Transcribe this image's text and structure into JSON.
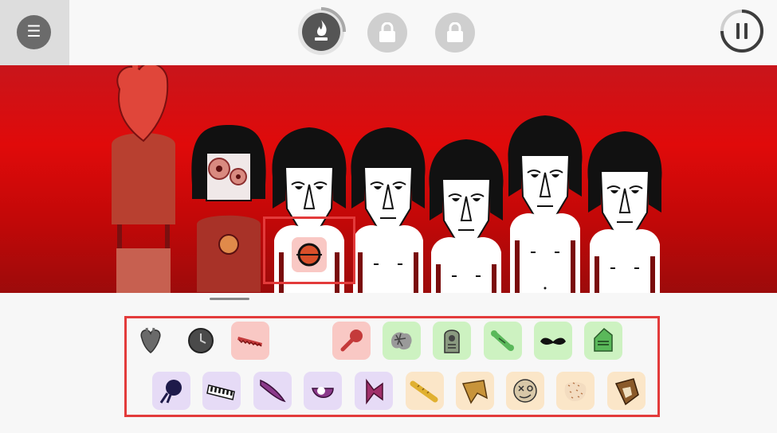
{
  "toolbar": {
    "menu_icon": "hamburger-icon",
    "bonus_buttons": [
      {
        "icon": "flame-icon",
        "state": "active",
        "progress": 0.35
      },
      {
        "icon": "lock-icon",
        "state": "locked"
      },
      {
        "icon": "lock-icon",
        "state": "locked"
      }
    ],
    "pause_icon": "pause-icon",
    "pause_progress": 0.25
  },
  "stage": {
    "background": "#d40b0b",
    "performers": [
      {
        "slot": 1,
        "state": "anatomical-heart"
      },
      {
        "slot": 2,
        "state": "gears-face"
      },
      {
        "slot": 3,
        "state": "idle",
        "selected": true
      },
      {
        "slot": 4,
        "state": "idle"
      },
      {
        "slot": 5,
        "state": "idle"
      },
      {
        "slot": 6,
        "state": "idle"
      },
      {
        "slot": 7,
        "state": "idle"
      }
    ],
    "dragging_sound": "microphone-ball-icon"
  },
  "palette": {
    "row1": [
      {
        "icon": "anatomical-heart-icon",
        "group": "beat",
        "used": true
      },
      {
        "icon": "clock-icon",
        "group": "beat",
        "used": true
      },
      {
        "icon": "saw-icon",
        "group": "beat",
        "used": false
      },
      {
        "icon": "empty-slot",
        "group": "beat",
        "used": true
      },
      {
        "icon": "microphone-icon",
        "group": "beat",
        "used": false
      },
      {
        "icon": "brain-icon",
        "group": "effect",
        "used": false
      },
      {
        "icon": "tombstone-icon",
        "group": "effect",
        "used": false
      },
      {
        "icon": "bone-icon",
        "group": "effect",
        "used": false
      },
      {
        "icon": "mustache-icon",
        "group": "effect",
        "used": false
      },
      {
        "icon": "helmet-icon",
        "group": "effect",
        "used": false
      }
    ],
    "row2": [
      {
        "icon": "comet-icon",
        "group": "melody"
      },
      {
        "icon": "keyboard-icon",
        "group": "melody"
      },
      {
        "icon": "claw-icon",
        "group": "melody"
      },
      {
        "icon": "eye-icon",
        "group": "melody"
      },
      {
        "icon": "bowtie-icon",
        "group": "melody"
      },
      {
        "icon": "baguette-icon",
        "group": "voice"
      },
      {
        "icon": "hat-icon",
        "group": "voice"
      },
      {
        "icon": "dizzy-face-icon",
        "group": "voice"
      },
      {
        "icon": "sponge-icon",
        "group": "voice"
      },
      {
        "icon": "skull-box-icon",
        "group": "voice"
      }
    ],
    "colors": {
      "beat": "#f9c8c4",
      "effect": "#cdf2c1",
      "melody": "#e6dbf6",
      "voice": "#fbe6c8"
    }
  }
}
